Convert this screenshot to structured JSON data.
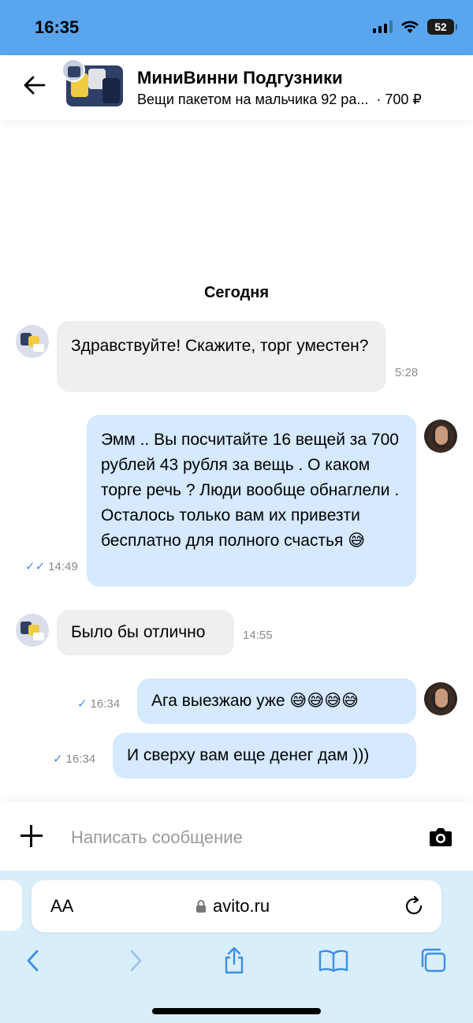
{
  "status_bar": {
    "time": "16:35",
    "battery": "52"
  },
  "header": {
    "title": "МиниВинни Подгузники",
    "item_title": "Вещи пакетом на мальчика 92 ра...",
    "price": "· 700 ₽"
  },
  "chat": {
    "date_label": "Сегодня",
    "messages": [
      {
        "direction": "incoming",
        "text": "Здравствуйте! Скажите, торг уместен?",
        "time": "5:28"
      },
      {
        "direction": "outgoing",
        "text": "Эмм .. Вы посчитайте 16 вещей за 700 рублей 43 рубля за вещь . О каком торге речь ?  Люди вообще обнаглели . Осталось только вам их привезти бесплатно для полного счастья 😅",
        "time": "14:49",
        "status": "read"
      },
      {
        "direction": "incoming",
        "text": "Было бы отлично",
        "time": "14:55"
      },
      {
        "direction": "outgoing",
        "text": "Ага выезжаю уже 😅😅😅😅",
        "time": "16:34",
        "status": "delivered"
      },
      {
        "direction": "outgoing",
        "text": "И сверху вам еще денег дам )))",
        "time": "16:34",
        "status": "delivered"
      }
    ]
  },
  "composer": {
    "placeholder": "Написать сообщение"
  },
  "browser": {
    "aa_label": "AA",
    "url": "avito.ru"
  },
  "icons": {
    "back": "arrow-left-icon",
    "camera": "camera-icon",
    "plus": "plus-icon",
    "lock": "lock-icon",
    "reload": "reload-icon",
    "share": "share-icon",
    "bookmarks": "book-icon",
    "tabs": "tabs-icon"
  },
  "colors": {
    "status_bar_bg": "#5aa6ee",
    "incoming_bubble": "#efefef",
    "outgoing_bubble": "#d5e9ff",
    "check": "#4a8fe0",
    "browser_bg": "#d9eefb"
  }
}
